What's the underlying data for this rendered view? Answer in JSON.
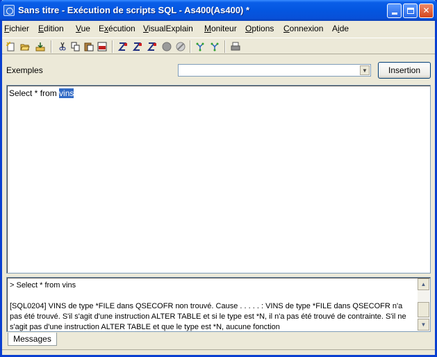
{
  "window": {
    "title": "Sans titre - Exécution de scripts SQL - As400(As400) *"
  },
  "menu": [
    {
      "label": "Fichier",
      "accel": "F",
      "rest": "ichier"
    },
    {
      "label": "Edition",
      "accel": "E",
      "rest": "dition"
    },
    {
      "label": "Vue",
      "accel": "V",
      "rest": "ue"
    },
    {
      "label": "Exécution",
      "accel": "x",
      "pre": "E",
      "rest": "écution"
    },
    {
      "label": "VisualExplain",
      "accel": "V",
      "rest": "isualExplain"
    },
    {
      "label": "Moniteur",
      "accel": "M",
      "rest": "oniteur"
    },
    {
      "label": "Options",
      "accel": "O",
      "rest": "ptions"
    },
    {
      "label": "Connexion",
      "accel": "C",
      "rest": "onnexion"
    },
    {
      "label": "Aide",
      "accel": "i",
      "pre": "A",
      "rest": "de"
    }
  ],
  "toolbar": {
    "icons": [
      "new-file-icon",
      "open-folder-icon",
      "save-icon",
      "cut-icon",
      "copy-icon",
      "paste-icon",
      "sql-icon",
      "run-all-icon",
      "run-from-cursor-icon",
      "run-selected-icon",
      "stop-icon",
      "cancel-icon",
      "explain-icon",
      "explain-run-icon",
      "print-icon"
    ]
  },
  "examples": {
    "label": "Exemples",
    "selected": "",
    "insert_label": "Insertion"
  },
  "editor": {
    "prefix": "Select * from ",
    "selected": "vins"
  },
  "messages": {
    "tab_label": "Messages",
    "lines": [
      "> Select * from vins",
      "",
      "[SQL0204] VINS de type *FILE dans QSECOFR non trouvé. Cause . . . . . : VINS de type *FILE dans QSECOFR n'a pas été trouvé. S'il s'agit d'une instruction ALTER TABLE et si le type est *N, il n'a pas été trouvé de contrainte. S'il ne s'agit pas d'une instruction ALTER TABLE et que le type est *N, aucune fonction"
    ]
  },
  "colors": {
    "titlebar": "#0456e0",
    "selection": "#316ac5",
    "window_bg": "#ece9d8"
  }
}
